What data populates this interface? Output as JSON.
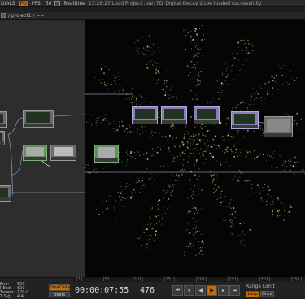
{
  "topbar": {
    "label_dials": "DIALS",
    "badge": "FO",
    "fps_label": "FPS:",
    "fps_value": "60",
    "realtime_label": "Realtime",
    "status_message": "13:26:27 Load Project .toe: TD_Digital Decay 2.toe loaded successfully."
  },
  "path": {
    "text": "/ project1 / >>"
  },
  "timeline": {
    "ruler_ticks": [
      "[1]",
      "[51]",
      "[101]",
      "[151]",
      "[201]",
      "[251]",
      "[301]",
      "[351]"
    ],
    "params": [
      {
        "label": "End:",
        "value": "600"
      },
      {
        "label": "REnd:",
        "value": "600"
      },
      {
        "label": "Tempo:",
        "value": "120.0"
      },
      {
        "label": "T Sig:",
        "value": "4    4"
      }
    ],
    "timecode_button": "TimeCode",
    "beats_button": "Beats",
    "timecode": "00:00:07:55",
    "frame": "476",
    "range_limit_label": "Range Limit",
    "loop_button": "Loop",
    "once_button": "Once"
  },
  "colors": {
    "accent": "#c56a00",
    "sop_node": "#8a7fb4",
    "top_node": "#5e8f5c",
    "wire": "#8a8ab0"
  }
}
